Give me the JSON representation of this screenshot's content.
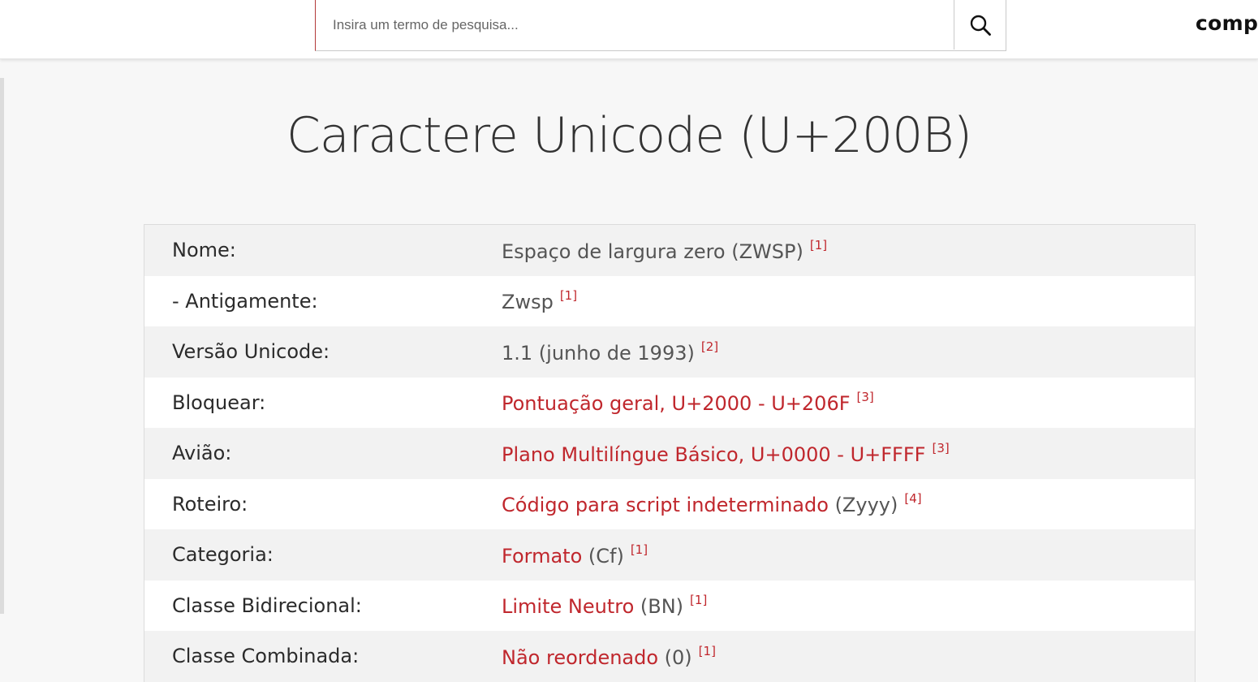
{
  "search": {
    "placeholder": "Insira um termo de pesquisa..."
  },
  "brand": {
    "text": "compart"
  },
  "page": {
    "title": "Caractere Unicode (U+200B)"
  },
  "rows": [
    {
      "label": "Nome:",
      "link": "",
      "value": "Espaço de largura zero (ZWSP)",
      "ref": "[1]"
    },
    {
      "label": "- Antigamente:",
      "link": "",
      "value": "Zwsp",
      "ref": "[1]"
    },
    {
      "label": "Versão Unicode:",
      "link": "",
      "value": "1.1 (junho de 1993)",
      "ref": "[2]"
    },
    {
      "label": "Bloquear:",
      "link": "Pontuação geral, U+2000 - U+206F",
      "value": "",
      "ref": "[3]"
    },
    {
      "label": "Avião:",
      "link": "Plano Multilíngue Básico, U+0000 - U+FFFF",
      "value": "",
      "ref": "[3]"
    },
    {
      "label": "Roteiro:",
      "link": "Código para script indeterminado",
      "value": " (Zyyy)",
      "ref": "[4]"
    },
    {
      "label": "Categoria:",
      "link": "Formato",
      "value": " (Cf)",
      "ref": "[1]"
    },
    {
      "label": "Classe Bidirecional:",
      "link": "Limite Neutro",
      "value": " (BN)",
      "ref": "[1]"
    },
    {
      "label": "Classe Combinada:",
      "link": "Não reordenado",
      "value": " (0)",
      "ref": "[1]"
    }
  ],
  "colors": {
    "accent": "#c0272d",
    "row_odd": "#f2f2f2",
    "row_even": "#ffffff",
    "page_bg": "#f7f7f7"
  },
  "icons": {
    "search": "search-icon"
  }
}
